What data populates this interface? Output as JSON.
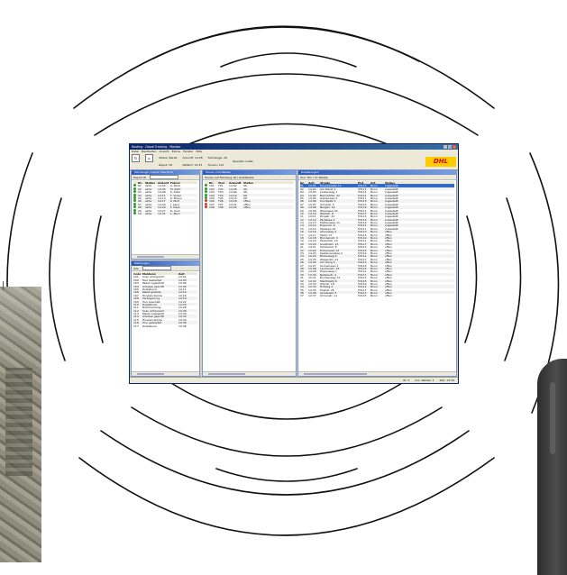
{
  "colors": {
    "arc_stroke": "#111111",
    "window_title": "#0a246a",
    "panel_title": "#2f5bb7",
    "selection": "#316ac5",
    "status_green": "#2a9a2a",
    "status_red": "#d23b1e",
    "brand_yellow": "#ffcc00",
    "brand_red": "#d40511"
  },
  "window": {
    "title": "Routing · Depot Tracking · Monitor",
    "controls": [
      "_",
      "□",
      "×"
    ],
    "menu": [
      "Datei",
      "Bearbeiten",
      "Ansicht",
      "Extras",
      "Fenster",
      "Hilfe"
    ],
    "toolbar": {
      "group1": [
        "Status: Bereit",
        "Depot: 18"
      ],
      "group2": [
        "Ankunft: 14:28",
        "Abfahrt: 14:35"
      ],
      "group3": [
        "Fahrzeuge: 26",
        "Touren: 112"
      ],
      "user": "Operator Leitst.",
      "brand": "DHL"
    },
    "status": [
      "ID: 4",
      "Anz. Pakete: 3",
      "Zeit: 14:39"
    ]
  },
  "panels": {
    "vehicles": {
      "title": "Fahrzeuge / Depot Übersicht",
      "filter": "Depot 18",
      "headers": [
        "",
        "Nr.",
        "Status",
        "Ankunft",
        "Fahrer"
      ],
      "rows": [
        [
          "g",
          "01",
          "aktiv",
          "14:02",
          "A. Beck"
        ],
        [
          "g",
          "02",
          "aktiv",
          "14:05",
          "M. Roth"
        ],
        [
          "g",
          "03",
          "aktiv",
          "14:08",
          "S. Klein"
        ],
        [
          "g",
          "04",
          "aktiv",
          "14:11",
          "T. Vogel"
        ],
        [
          "g",
          "05",
          "aktiv",
          "14:13",
          "K. Braun"
        ],
        [
          "g",
          "06",
          "aktiv",
          "14:17",
          "P. Wolf"
        ],
        [
          "g",
          "07",
          "aktiv",
          "14:20",
          "J. Lang"
        ],
        [
          "g",
          "08",
          "aktiv",
          "14:24",
          "F. Haas"
        ],
        [
          "g",
          "09",
          "aktiv",
          "14:27",
          "D. Kurz"
        ],
        [
          "g",
          "10",
          "aktiv",
          "14:31",
          "L. Berg"
        ]
      ]
    },
    "messages": {
      "title": "Meldungen",
      "filter": "Alle",
      "headers": [
        "Code",
        "Meldung",
        "Zeit"
      ],
      "rows": [
        [
          "101",
          "Scan erfolgreich",
          "14:01"
        ],
        [
          "102",
          "Tour gestartet",
          "14:03"
        ],
        [
          "103",
          "Paket zugestellt",
          "14:06"
        ],
        [
          "104",
          "Adresse geprüft",
          "14:09"
        ],
        [
          "105",
          "Zustellung",
          "14:11"
        ],
        [
          "106",
          "Paket geladen",
          "14:14"
        ],
        [
          "107",
          "Hinweis Kunde",
          "14:16"
        ],
        [
          "108",
          "Verzögerung",
          "14:19"
        ],
        [
          "109",
          "Tour beendet",
          "14:22"
        ],
        [
          "110",
          "Zustellung",
          "14:24"
        ],
        [
          "111",
          "Rückmeldung",
          "14:26"
        ],
        [
          "112",
          "Scan erfolgreich",
          "14:28"
        ],
        [
          "113",
          "Paket zugestellt",
          "14:30"
        ],
        [
          "114",
          "Adresse geprüft",
          "14:32"
        ],
        [
          "115",
          "Hinweis Kunde",
          "14:34"
        ],
        [
          "116",
          "Tour gestartet",
          "14:36"
        ],
        [
          "117",
          "Zustellung",
          "14:38"
        ]
      ]
    },
    "tours": {
      "title": "Touren und Pakete",
      "sub": "Touren auf Fahrzeug 18 / Zustellliste",
      "headers": [
        "",
        "Nr.",
        "Tour",
        "Ankunft",
        "Status"
      ],
      "rows": [
        [
          "g",
          "101",
          "T01",
          "14:02",
          "OK"
        ],
        [
          "g",
          "102",
          "T02",
          "14:06",
          "OK"
        ],
        [
          "g",
          "103",
          "T03",
          "14:09",
          "OK"
        ],
        [
          "g",
          "104",
          "T04",
          "14:12",
          "OK"
        ],
        [
          "g",
          "105",
          "T05",
          "14:15",
          "OK"
        ],
        [
          "r",
          "106",
          "T06",
          "14:18",
          "offen"
        ],
        [
          "r",
          "107",
          "T07",
          "14:21",
          "offen"
        ],
        [
          "r",
          "108",
          "T08",
          "14:25",
          "offen"
        ]
      ]
    },
    "deliveries": {
      "title": "Zustellungen",
      "sub": "Tour T01 / 37 Pakete",
      "headers": [
        "Nr.",
        "Zeit",
        "Straße",
        "PLZ",
        "Ort",
        "Status"
      ],
      "rows": [
        [
          "01",
          "14:01",
          "Hauptstraße 12",
          "53113",
          "Bonn",
          "zugestellt"
        ],
        [
          "02",
          "14:02",
          "Am Markt 3",
          "53113",
          "Bonn",
          "zugestellt"
        ],
        [
          "03",
          "14:03",
          "Lindenweg 7",
          "53115",
          "Bonn",
          "zugestellt"
        ],
        [
          "04",
          "14:04",
          "Bahnhofstr. 22",
          "53111",
          "Bonn",
          "zugestellt"
        ],
        [
          "05",
          "14:05",
          "Gartenweg 5",
          "53117",
          "Bonn",
          "zugestellt"
        ],
        [
          "06",
          "14:06",
          "Kirchplatz 1",
          "53113",
          "Bonn",
          "zugestellt"
        ],
        [
          "07",
          "14:07",
          "Schulstr. 9",
          "53115",
          "Bonn",
          "zugestellt"
        ],
        [
          "08",
          "14:08",
          "Bergstr. 14",
          "53119",
          "Bonn",
          "zugestellt"
        ],
        [
          "09",
          "14:09",
          "Rheinweg 30",
          "53111",
          "Bonn",
          "zugestellt"
        ],
        [
          "10",
          "14:10",
          "Waldstr. 8",
          "53117",
          "Bonn",
          "zugestellt"
        ],
        [
          "11",
          "14:11",
          "Ringstr. 41",
          "53113",
          "Bonn",
          "zugestellt"
        ],
        [
          "12",
          "14:12",
          "Parkallee 2",
          "53115",
          "Bonn",
          "zugestellt"
        ],
        [
          "13",
          "14:13",
          "Mühlenweg 11",
          "53119",
          "Bonn",
          "zugestellt"
        ],
        [
          "14",
          "14:14",
          "Rosenstr. 6",
          "53111",
          "Bonn",
          "zugestellt"
        ],
        [
          "15",
          "14:15",
          "Feldweg 19",
          "53117",
          "Bonn",
          "zugestellt"
        ],
        [
          "16",
          "14:16",
          "Ahornweg 4",
          "53113",
          "Bonn",
          "offen"
        ],
        [
          "17",
          "14:17",
          "Talstr. 27",
          "53115",
          "Bonn",
          "offen"
        ],
        [
          "18",
          "14:18",
          "Brückenstr. 3",
          "53119",
          "Bonn",
          "offen"
        ],
        [
          "19",
          "14:19",
          "Mozartstr. 10",
          "53111",
          "Bonn",
          "offen"
        ],
        [
          "20",
          "14:20",
          "Goethestr. 15",
          "53117",
          "Bonn",
          "offen"
        ],
        [
          "21",
          "14:21",
          "Schillerstr. 8",
          "53113",
          "Bonn",
          "offen"
        ],
        [
          "22",
          "14:22",
          "Eichenweg 13",
          "53115",
          "Bonn",
          "offen"
        ],
        [
          "23",
          "14:23",
          "Kastanienallee 2",
          "53119",
          "Bonn",
          "offen"
        ],
        [
          "24",
          "14:24",
          "Birkenweg 9",
          "53111",
          "Bonn",
          "offen"
        ],
        [
          "25",
          "14:25",
          "Wiesenstr. 21",
          "53117",
          "Bonn",
          "offen"
        ],
        [
          "26",
          "14:26",
          "Am Hang 5",
          "53113",
          "Bonn",
          "offen"
        ],
        [
          "27",
          "14:27",
          "Sonnenweg 1",
          "53115",
          "Bonn",
          "offen"
        ],
        [
          "28",
          "14:28",
          "Lerchenstr. 16",
          "53119",
          "Bonn",
          "offen"
        ],
        [
          "29",
          "14:29",
          "Tulpenweg 7",
          "53111",
          "Bonn",
          "offen"
        ],
        [
          "30",
          "14:30",
          "Nelkenstr. 4",
          "53117",
          "Bonn",
          "offen"
        ],
        [
          "31",
          "14:31",
          "Buchenweg 12",
          "53113",
          "Bonn",
          "offen"
        ],
        [
          "32",
          "14:32",
          "Marktplatz 6",
          "53115",
          "Bonn",
          "offen"
        ],
        [
          "33",
          "14:33",
          "Uferstr. 18",
          "53119",
          "Bonn",
          "offen"
        ],
        [
          "34",
          "14:34",
          "Hofweg 2",
          "53111",
          "Bonn",
          "offen"
        ],
        [
          "35",
          "14:35",
          "Poststr. 25",
          "53117",
          "Bonn",
          "offen"
        ],
        [
          "36",
          "14:36",
          "Amselweg 3",
          "53113",
          "Bonn",
          "offen"
        ],
        [
          "37",
          "14:37",
          "Ulmenstr. 11",
          "53115",
          "Bonn",
          "offen"
        ]
      ]
    }
  }
}
